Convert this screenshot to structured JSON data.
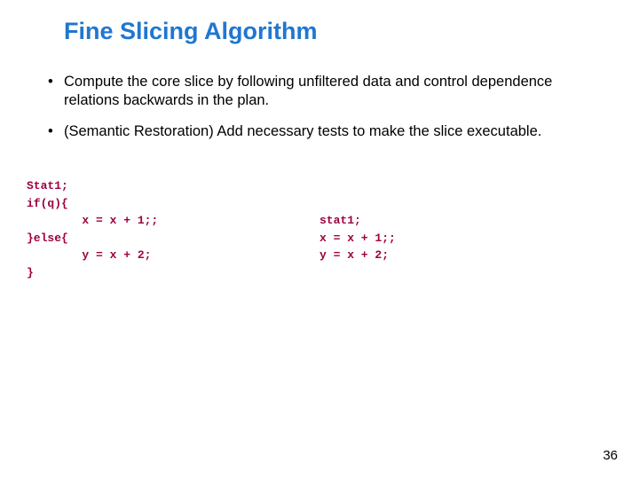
{
  "title": "Fine Slicing Algorithm",
  "bullets": [
    "Compute the core slice by following unfiltered  data and control dependence relations backwards in the plan.",
    "(Semantic Restoration) Add necessary tests to make the slice executable."
  ],
  "code_left": {
    "l1": "Stat1;",
    "l2": "if(q){",
    "l3": "        x = x + 1;;",
    "l4": "}else{",
    "l5": "        y = x + 2;",
    "l6": "}"
  },
  "code_right": {
    "l1": "stat1;",
    "l2": "x = x + 1;;",
    "l3": "y = x + 2;"
  },
  "page_number": "36"
}
